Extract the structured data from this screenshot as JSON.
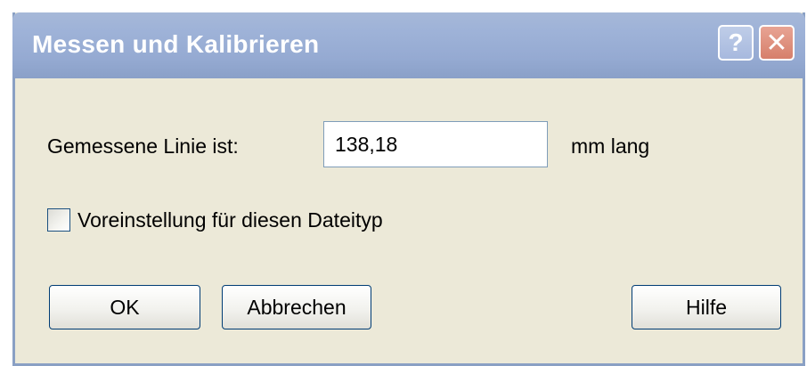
{
  "window": {
    "title": "Messen und Kalibrieren",
    "help_icon": "?",
    "close_icon": "✕"
  },
  "form": {
    "line_label": "Gemessene Linie ist:",
    "line_value": "138,18",
    "unit_label": "mm lang",
    "checkbox_label": "Voreinstellung für diesen Dateityp",
    "checkbox_checked": false
  },
  "buttons": {
    "ok": "OK",
    "cancel": "Abbrechen",
    "help": "Hilfe"
  },
  "colors": {
    "titlebar": "#9fb3d8",
    "dialog_bg": "#ece9d8",
    "close_button": "#d67f6b"
  }
}
